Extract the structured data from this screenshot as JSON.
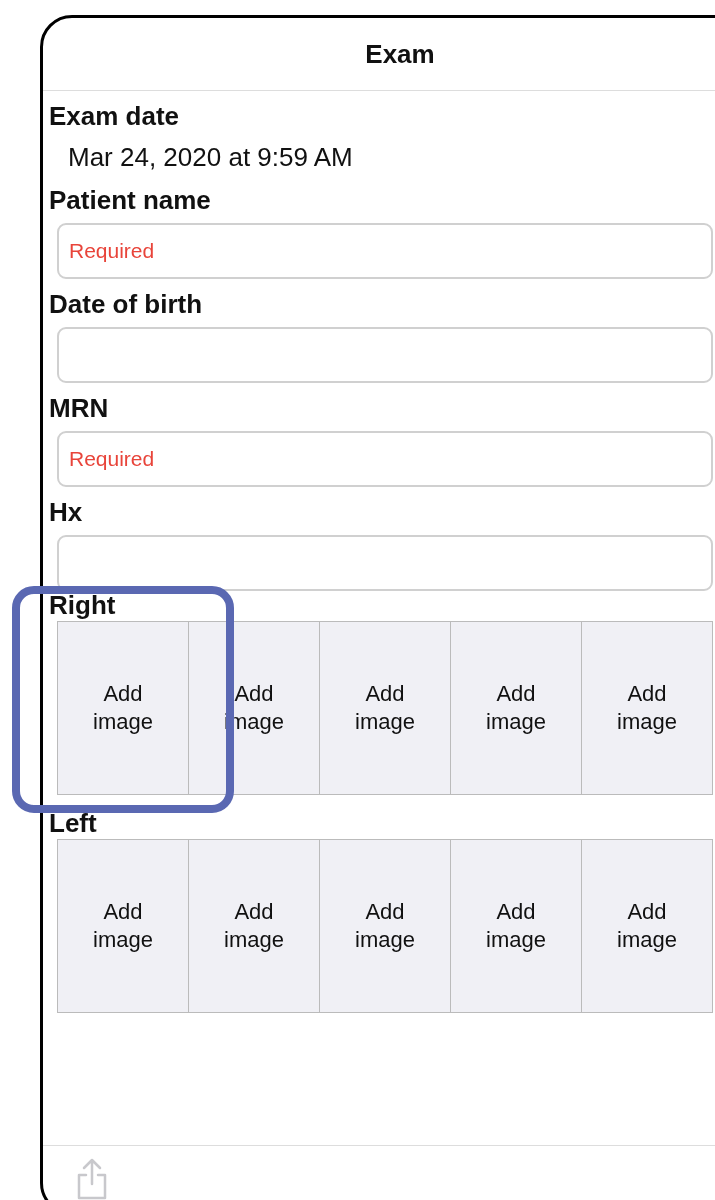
{
  "header": {
    "title": "Exam"
  },
  "fields": [
    {
      "kind": "value",
      "label": "Exam date",
      "value": "Mar 24, 2020 at 9:59 AM"
    },
    {
      "kind": "input",
      "label": "Patient name",
      "placeholder": "Required"
    },
    {
      "kind": "input",
      "label": "Date of birth"
    },
    {
      "kind": "input",
      "label": "MRN",
      "placeholder": "Required"
    },
    {
      "kind": "input",
      "label": "Hx"
    }
  ],
  "image_sections": [
    {
      "label": "Right",
      "tiles": [
        {
          "label": "Add image",
          "highlighted": true
        },
        {
          "label": "Add image",
          "highlighted": false
        },
        {
          "label": "Add image",
          "highlighted": false
        },
        {
          "label": "Add image",
          "highlighted": false
        },
        {
          "label": "Add image",
          "highlighted": false
        }
      ]
    },
    {
      "label": "Left",
      "tiles": [
        {
          "label": "Add image",
          "highlighted": false
        },
        {
          "label": "Add image",
          "highlighted": false
        },
        {
          "label": "Add image",
          "highlighted": false
        },
        {
          "label": "Add image",
          "highlighted": false
        },
        {
          "label": "Add image",
          "highlighted": false
        }
      ]
    }
  ]
}
